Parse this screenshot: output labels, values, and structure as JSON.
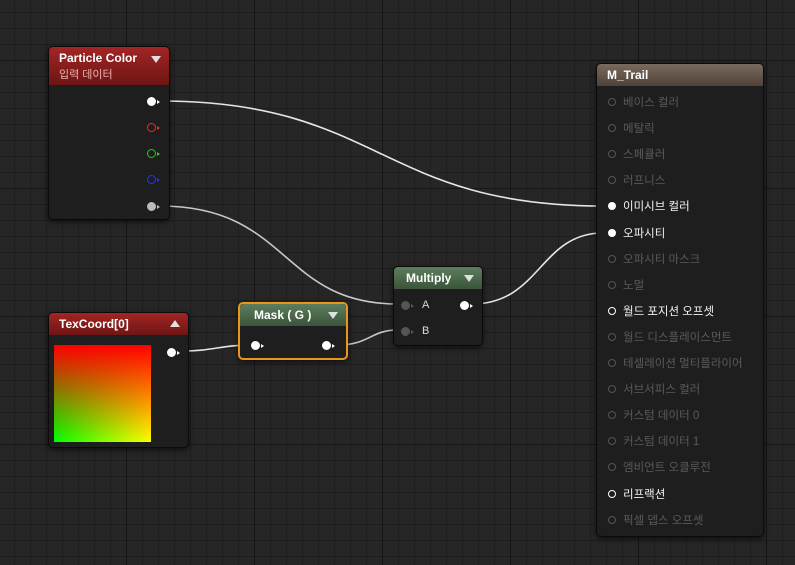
{
  "nodes": {
    "particle_color": {
      "title": "Particle Color",
      "subtitle": "입력 데이터",
      "header_color": "#8b1d1d",
      "pins": [
        {
          "name": "rgb-output-pin",
          "color": "#ffffff"
        },
        {
          "name": "red-output-pin",
          "color": "#ff2222"
        },
        {
          "name": "green-output-pin",
          "color": "#22cc22"
        },
        {
          "name": "blue-output-pin",
          "color": "#2233ff"
        },
        {
          "name": "alpha-output-pin",
          "color": "#bbbbbb"
        }
      ]
    },
    "texcoord": {
      "title": "TexCoord[0]",
      "header_color": "#8b1d1d"
    },
    "mask": {
      "title": "Mask ( G )",
      "header_color": "#4d6a4d",
      "selected_color": "#e8961e"
    },
    "multiply": {
      "title": "Multiply",
      "header_color": "#4d6a4d",
      "inputs": [
        "A",
        "B"
      ]
    },
    "m_trail": {
      "title": "M_Trail",
      "header_color": "#6b5a4d",
      "outputs": [
        {
          "label": "베이스 컬러",
          "state": "inactive"
        },
        {
          "label": "메탈릭",
          "state": "inactive"
        },
        {
          "label": "스페큘러",
          "state": "inactive"
        },
        {
          "label": "러프니스",
          "state": "inactive"
        },
        {
          "label": "이미시브 컬러",
          "state": "connected"
        },
        {
          "label": "오파시티",
          "state": "connected"
        },
        {
          "label": "오파시티 마스크",
          "state": "inactive"
        },
        {
          "label": "노멀",
          "state": "inactive"
        },
        {
          "label": "월드 포지션 오프셋",
          "state": "active"
        },
        {
          "label": "월드 디스플레이스먼트",
          "state": "inactive"
        },
        {
          "label": "테셀레이션 멀티플라이어",
          "state": "inactive"
        },
        {
          "label": "서브서피스 컬러",
          "state": "inactive"
        },
        {
          "label": "커스텀 데이터 0",
          "state": "inactive"
        },
        {
          "label": "커스텀 데이터 1",
          "state": "inactive"
        },
        {
          "label": "엠비언트 오클루전",
          "state": "inactive"
        },
        {
          "label": "리프랙션",
          "state": "active"
        },
        {
          "label": "픽셀 뎁스 오프셋",
          "state": "inactive"
        }
      ]
    }
  }
}
